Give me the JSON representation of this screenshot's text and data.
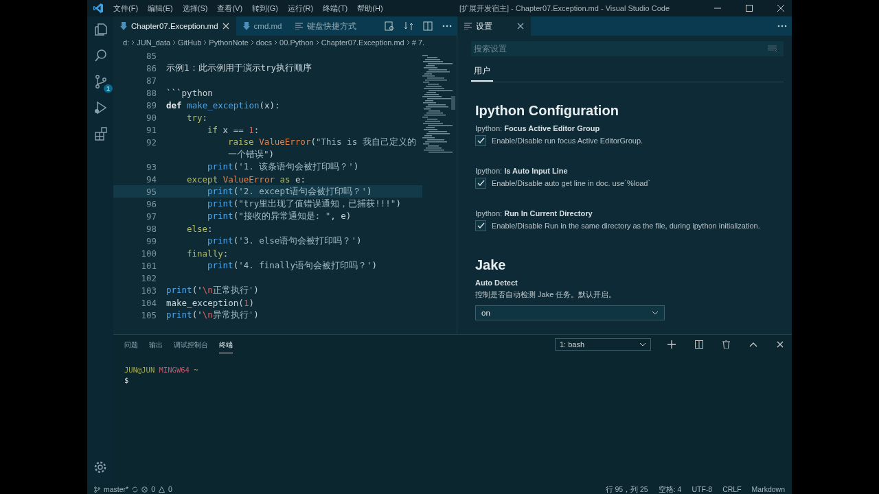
{
  "menu_bar": {
    "items": [
      "文件(F)",
      "编辑(E)",
      "选择(S)",
      "查看(V)",
      "转到(G)",
      "运行(R)",
      "终端(T)",
      "帮助(H)"
    ],
    "title": "[扩展开发宿主] - Chapter07.Exception.md - Visual Studio Code"
  },
  "activity_bar": {
    "items": [
      {
        "kind": "files",
        "selected": false
      },
      {
        "kind": "search",
        "selected": false
      },
      {
        "kind": "scm",
        "selected": false,
        "badge": "1"
      },
      {
        "kind": "run",
        "selected": false
      },
      {
        "kind": "extensions",
        "selected": false
      }
    ]
  },
  "editor": {
    "tabs": [
      {
        "label": "Chapter07.Exception.md",
        "kind": "markdown",
        "selected": true
      },
      {
        "label": "cmd.md",
        "kind": "markdown",
        "selected": false
      },
      {
        "label": "键盘快捷方式",
        "kind": "keyboard",
        "selected": false
      }
    ],
    "breadcrumb": [
      "d:",
      "JUN_data",
      "GitHub",
      "PythonNote",
      "docs",
      "00.Python",
      "Chapter07.Exception.md",
      "# 7."
    ],
    "lines": [
      {
        "number": "85",
        "kind": "top",
        "current": false
      },
      {
        "number": "86",
        "kind": "top",
        "current": false,
        "tokens": [
          {
            "text": "示例1：此示例用于演示try执行顺序",
            "kind": "plain"
          }
        ]
      },
      {
        "number": "87",
        "kind": "top",
        "current": false
      },
      {
        "number": "88",
        "kind": "top",
        "current": false,
        "tokens": [
          {
            "text": "```python",
            "kind": "plain"
          }
        ]
      },
      {
        "number": "89",
        "kind": "top",
        "current": false,
        "tokens": [
          {
            "text": "def ",
            "kind": "def"
          },
          {
            "text": "make_exception",
            "kind": "func"
          },
          {
            "text": "(x):",
            "kind": "plain"
          }
        ]
      },
      {
        "number": "90",
        "kind": "single",
        "current": false,
        "tokens": [
          {
            "text": "try",
            "kind": "keyword"
          },
          {
            "text": ":",
            "kind": "plain"
          }
        ]
      },
      {
        "number": "91",
        "kind": "double",
        "current": false,
        "tokens": [
          {
            "text": "if ",
            "kind": "keyword"
          },
          {
            "text": "x ",
            "kind": "plain"
          },
          {
            "text": "== ",
            "kind": "keyword"
          },
          {
            "text": "1",
            "kind": "number"
          },
          {
            "text": ":",
            "kind": "plain"
          }
        ]
      },
      {
        "number": "92",
        "kind": "triple",
        "current": false,
        "tokens": [
          {
            "text": "raise ",
            "kind": "keyword"
          },
          {
            "text": "ValueError",
            "kind": "class"
          },
          {
            "text": "(",
            "kind": "plain"
          },
          {
            "text": "\"This is 我自己定义的",
            "kind": "string"
          }
        ]
      },
      {
        "kind": "triple",
        "current": false,
        "tokens": [
          {
            "text": "一个错误\"",
            "kind": "string"
          },
          {
            "text": ")",
            "kind": "plain"
          }
        ]
      },
      {
        "number": "93",
        "kind": "double",
        "current": false,
        "tokens": [
          {
            "text": "print",
            "kind": "func"
          },
          {
            "text": "(",
            "kind": "plain"
          },
          {
            "text": "'1. 该条语句会被打印吗？'",
            "kind": "string"
          },
          {
            "text": ")",
            "kind": "plain"
          }
        ]
      },
      {
        "number": "94",
        "kind": "single",
        "current": false,
        "tokens": [
          {
            "text": "except ",
            "kind": "keyword"
          },
          {
            "text": "ValueError ",
            "kind": "class"
          },
          {
            "text": "as ",
            "kind": "keyword"
          },
          {
            "text": "e:",
            "kind": "plain"
          }
        ]
      },
      {
        "number": "95",
        "kind": "double",
        "current": true,
        "tokens": [
          {
            "text": "print",
            "kind": "func"
          },
          {
            "text": "(",
            "kind": "plain"
          },
          {
            "text": "'2. except语句会被打印吗？'",
            "kind": "string"
          },
          {
            "text": ")",
            "kind": "plain"
          }
        ]
      },
      {
        "number": "96",
        "kind": "double",
        "current": false,
        "tokens": [
          {
            "text": "print",
            "kind": "func"
          },
          {
            "text": "(",
            "kind": "plain"
          },
          {
            "text": "\"try里出现了值错误通知，已捕获!!!\"",
            "kind": "string"
          },
          {
            "text": ")",
            "kind": "plain"
          }
        ]
      },
      {
        "number": "97",
        "kind": "double",
        "current": false,
        "tokens": [
          {
            "text": "print",
            "kind": "func"
          },
          {
            "text": "(",
            "kind": "plain"
          },
          {
            "text": "\"接收的异常通知是: \"",
            "kind": "string"
          },
          {
            "text": ", e)",
            "kind": "plain"
          }
        ]
      },
      {
        "number": "98",
        "kind": "single",
        "current": false,
        "tokens": [
          {
            "text": "else",
            "kind": "keyword"
          },
          {
            "text": ":",
            "kind": "plain"
          }
        ]
      },
      {
        "number": "99",
        "kind": "double",
        "current": false,
        "tokens": [
          {
            "text": "print",
            "kind": "func"
          },
          {
            "text": "(",
            "kind": "plain"
          },
          {
            "text": "'3. else语句会被打印吗？'",
            "kind": "string"
          },
          {
            "text": ")",
            "kind": "plain"
          }
        ]
      },
      {
        "number": "100",
        "kind": "single",
        "current": false,
        "tokens": [
          {
            "text": "finally",
            "kind": "keyword"
          },
          {
            "text": ":",
            "kind": "plain"
          }
        ]
      },
      {
        "number": "101",
        "kind": "double",
        "current": false,
        "tokens": [
          {
            "text": "print",
            "kind": "func"
          },
          {
            "text": "(",
            "kind": "plain"
          },
          {
            "text": "'4. finally语句会被打印吗？'",
            "kind": "string"
          },
          {
            "text": ")",
            "kind": "plain"
          }
        ]
      },
      {
        "number": "102",
        "kind": "top",
        "current": false
      },
      {
        "number": "103",
        "kind": "top",
        "current": false,
        "tokens": [
          {
            "text": "print",
            "kind": "func"
          },
          {
            "text": "('",
            "kind": "plain"
          },
          {
            "text": "\\n",
            "kind": "escape"
          },
          {
            "text": "正常执行'",
            "kind": "string"
          },
          {
            "text": ")",
            "kind": "plain"
          }
        ]
      },
      {
        "number": "104",
        "kind": "top",
        "current": false,
        "tokens": [
          {
            "text": "make_exception(",
            "kind": "plain"
          },
          {
            "text": "1",
            "kind": "number"
          },
          {
            "text": ")",
            "kind": "plain"
          }
        ]
      },
      {
        "number": "105",
        "kind": "top",
        "current": false,
        "tokens": [
          {
            "text": "print",
            "kind": "func"
          },
          {
            "text": "('",
            "kind": "plain"
          },
          {
            "text": "\\n",
            "kind": "escape"
          },
          {
            "text": "异常执行'",
            "kind": "string"
          },
          {
            "text": ")",
            "kind": "plain"
          }
        ]
      }
    ]
  },
  "settings": {
    "tab": {
      "label": "设置",
      "selected": true
    },
    "search": {
      "placeholder": "搜索设置"
    },
    "scope_tabs": [
      {
        "label": "用户",
        "selected": true
      }
    ],
    "sections": [
      {
        "heading": "Ipython Configuration",
        "items": [
          {
            "kind": "checkbox",
            "prefix": "Ipython: ",
            "name": "Focus Active Editor Group",
            "description": "Enable/Disable run focus Active EditorGroup.",
            "checked": true
          },
          {
            "kind": "checkbox",
            "prefix": "Ipython: ",
            "name": "Is Auto Input Line",
            "description": "Enable/Disable auto get line in doc. use`%load`",
            "checked": true
          },
          {
            "kind": "checkbox",
            "prefix": "Ipython: ",
            "name": "Run In Current Directory",
            "description": "Enable/Disable Run in the same directory as the file, during ipython initialization.",
            "checked": true
          }
        ]
      },
      {
        "heading": "Jake",
        "items": [
          {
            "kind": "select",
            "name": "Auto Detect",
            "description": "控制是否自动检测 Jake 任务。默认开启。",
            "value": "on"
          }
        ]
      }
    ]
  },
  "panel": {
    "tabs": [
      {
        "label": "问题",
        "selected": false
      },
      {
        "label": "输出",
        "selected": false
      },
      {
        "label": "调试控制台",
        "selected": false
      },
      {
        "label": "终端",
        "selected": true
      }
    ],
    "terminal_select": "1: bash",
    "terminal": {
      "user": "JUN@JUN",
      "system": "MINGW64",
      "path": "~",
      "prompt": "$"
    }
  },
  "status_bar": {
    "branch": "master*",
    "errors": "0",
    "warnings": "0",
    "right": [
      "行 95，列 25",
      "空格: 4",
      "UTF-8",
      "CRLF",
      "Markdown"
    ]
  }
}
